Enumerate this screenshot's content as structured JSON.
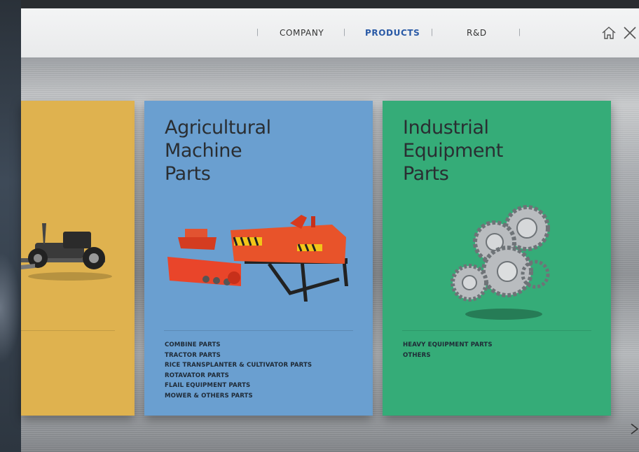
{
  "nav": {
    "items": [
      {
        "label": "COMPANY",
        "active": false
      },
      {
        "label": "PRODUCTS",
        "active": true
      },
      {
        "label": "R&D",
        "active": false
      }
    ],
    "home_icon": "home-icon",
    "close_icon": "close-icon"
  },
  "cards": [
    {
      "id": "automotive",
      "color": "#dfb24f",
      "title_lines": [],
      "items": [],
      "image": "car-chassis-image"
    },
    {
      "id": "agricultural",
      "color": "#6a9fd0",
      "title_lines": [
        "Agricultural",
        "Machine",
        "Parts"
      ],
      "items": [
        "COMBINE PARTS",
        "TRACTOR PARTS",
        "RICE TRANSPLANTER & CULTIVATOR PARTS",
        "ROTAVATOR PARTS",
        "FLAIL EQUIPMENT PARTS",
        "MOWER & OTHERS PARTS"
      ],
      "image": "rotavator-image"
    },
    {
      "id": "industrial",
      "color": "#35ac78",
      "title_lines": [
        "Industrial",
        "Equipment",
        "Parts"
      ],
      "items": [
        "HEAVY EQUIPMENT PARTS",
        "OTHERS"
      ],
      "image": "gears-image"
    }
  ],
  "next_icon": "chevron-right-icon"
}
